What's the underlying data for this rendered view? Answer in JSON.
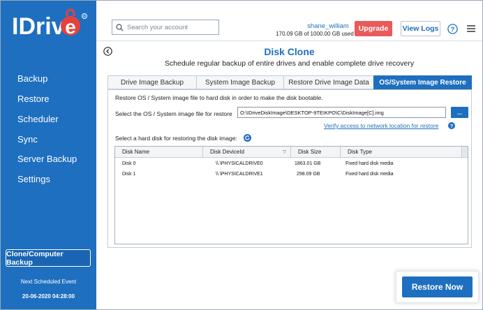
{
  "app": {
    "logo_text": "IDriv",
    "logo_e": "e"
  },
  "sidebar": {
    "items": [
      {
        "label": "Backup"
      },
      {
        "label": "Restore"
      },
      {
        "label": "Scheduler"
      },
      {
        "label": "Sync"
      },
      {
        "label": "Server Backup"
      },
      {
        "label": "Settings"
      }
    ],
    "clone_button": "Clone/Computer Backup",
    "next_event_label": "Next Scheduled Event",
    "next_event_date": "20-06-2020 04:28:00"
  },
  "header": {
    "search_placeholder": "Search your account",
    "username": "shane_william",
    "usage": "170.09 GB of 1000.00 GB used",
    "upgrade_label": "Upgrade",
    "view_logs_label": "View Logs"
  },
  "page": {
    "title": "Disk Clone",
    "subtitle": "Schedule regular backup of entire drives and enable complete drive recovery"
  },
  "tabs": [
    {
      "label": "Drive Image Backup",
      "active": false
    },
    {
      "label": "System Image Backup",
      "active": false
    },
    {
      "label": "Restore Drive Image Data",
      "active": false
    },
    {
      "label": "OS/System Image Restore",
      "active": true
    }
  ],
  "panel": {
    "description": "Restore OS / System image file to hard disk in order to make the disk bootable.",
    "select_label": "Select the OS / System image file for restore",
    "image_path": "O:\\IDriveDiskImage\\DESKTOP-9TEIKPO\\C\\DiskImage[C].img",
    "browse_label": "...",
    "verify_link": "Verify access to network location for restore",
    "disk_label": "Select a hard disk for restoring the disk image:"
  },
  "table": {
    "columns": [
      "Disk Name",
      "Disk DeviceId",
      "Disk Size",
      "Disk Type"
    ],
    "rows": [
      [
        "Disk 0",
        "\\\\.\\PHYSICALDRIVE0",
        "1863.01 GB",
        "Fixed hard disk media"
      ],
      [
        "Disk 1",
        "\\\\.\\PHYSICALDRIVE1",
        "298.09 GB",
        "Fixed hard disk media"
      ]
    ]
  },
  "restore_button": "Restore Now",
  "colors": {
    "brand_blue": "#1e6fbf",
    "upgrade_red": "#e85b5b",
    "logo_red": "#e8413c"
  }
}
